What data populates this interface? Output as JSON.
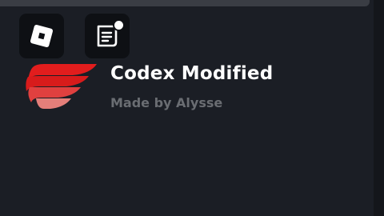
{
  "window": {
    "title": "Codex Modified",
    "subtitle": "Made by Alysse"
  },
  "topbar": {
    "roblox_icon": "roblox-logo-icon",
    "chat_icon": "chat-icon",
    "chat_has_notification": true
  },
  "brand": {
    "logo_icon": "codex-logo-icon",
    "accent_color": "#e0201e"
  }
}
